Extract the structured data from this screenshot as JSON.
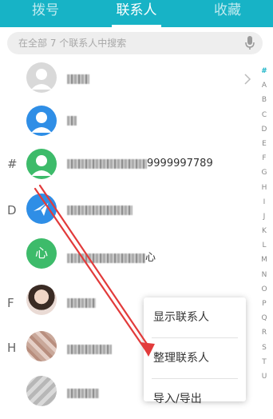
{
  "tabs": [
    {
      "label": "拨号"
    },
    {
      "label": "联系人"
    },
    {
      "label": "收藏"
    }
  ],
  "active_tab": "联系人",
  "search": {
    "placeholder": "在全部 7 个联系人中搜索"
  },
  "contacts": [
    {
      "name_suffix": "",
      "section": ""
    },
    {
      "name_suffix": "",
      "section": ""
    },
    {
      "name_suffix": "9999997789",
      "section": "#"
    },
    {
      "name_suffix": "",
      "section": "D"
    },
    {
      "name_suffix": "心",
      "section": "",
      "avatar_text": "心"
    },
    {
      "name_suffix": "",
      "section": "F"
    },
    {
      "name_suffix": "",
      "section": "H"
    },
    {
      "name_suffix": "",
      "section": ""
    }
  ],
  "index_letters": [
    "#",
    "A",
    "B",
    "C",
    "D",
    "E",
    "F",
    "G",
    "H",
    "I",
    "J",
    "K",
    "L",
    "M",
    "N",
    "O",
    "P",
    "Q",
    "R",
    "S",
    "T",
    "U"
  ],
  "menu": {
    "items": [
      "显示联系人",
      "整理联系人",
      "导入/导出"
    ]
  },
  "colors": {
    "accent": "#17b3c6",
    "annotation_arrow": "#e23b3b",
    "avatar_green": "#3dbb6a",
    "avatar_blue": "#2f8ee6"
  }
}
